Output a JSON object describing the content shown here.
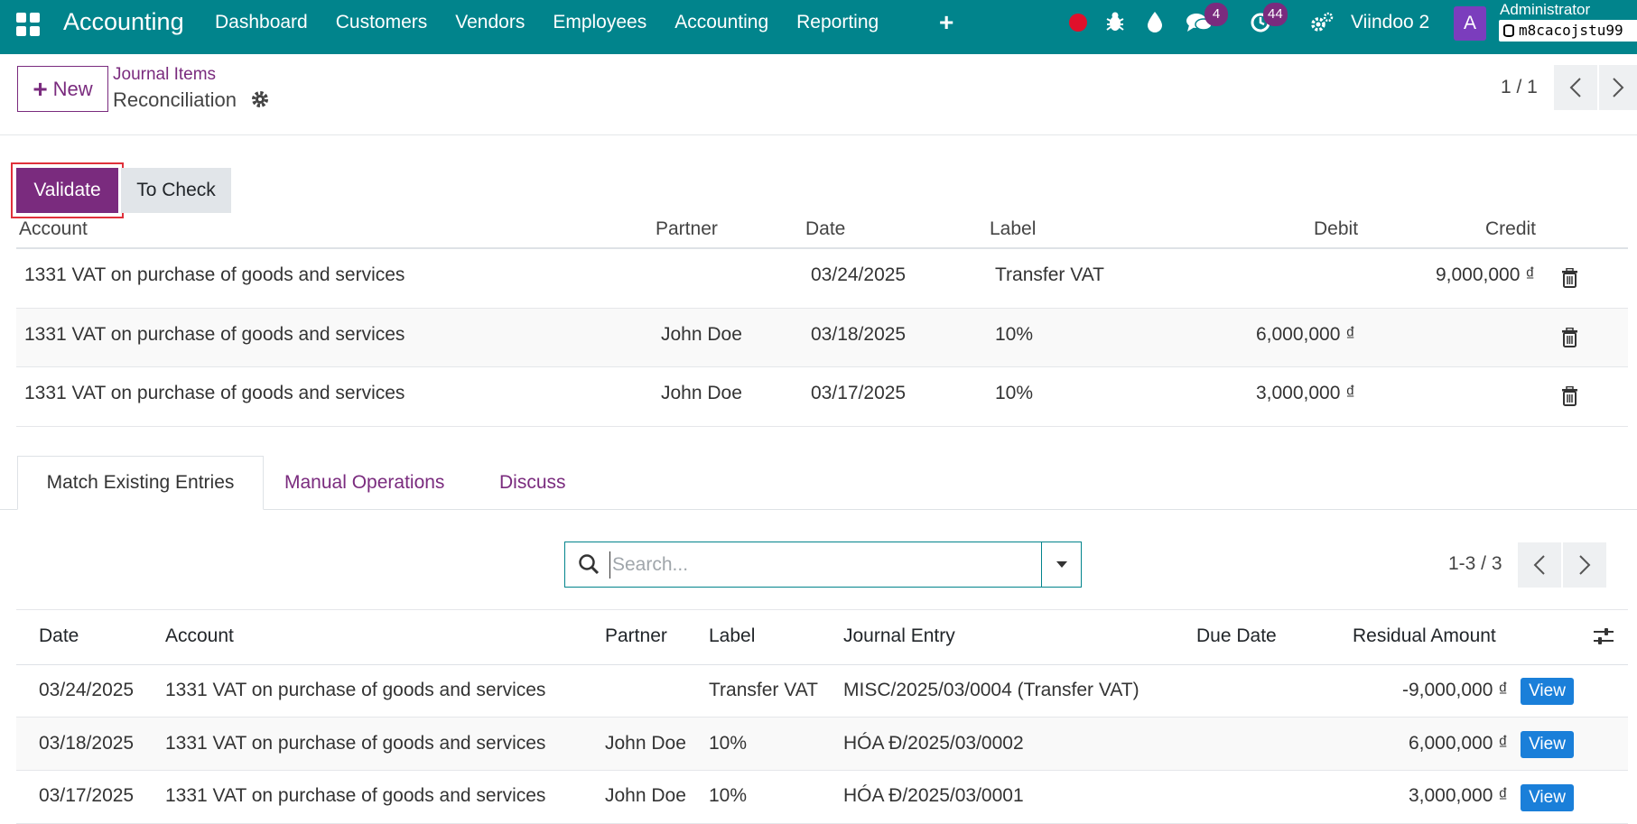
{
  "navbar": {
    "brand": "Accounting",
    "menu": [
      "Dashboard",
      "Customers",
      "Vendors",
      "Employees",
      "Accounting",
      "Reporting"
    ],
    "messages_badge": "4",
    "activities_badge": "44",
    "company": "Viindoo 2",
    "avatar_letter": "A",
    "user_name": "Administrator",
    "database": "m8cacojstu99"
  },
  "control": {
    "new_label": "New",
    "breadcrumb_parent": "Journal Items",
    "breadcrumb_current": "Reconciliation",
    "pager": "1 / 1"
  },
  "actions": {
    "validate_label": "Validate",
    "to_check_label": "To Check"
  },
  "lines": {
    "headers": {
      "account": "Account",
      "partner": "Partner",
      "date": "Date",
      "label": "Label",
      "debit": "Debit",
      "credit": "Credit"
    },
    "rows": [
      {
        "account": "1331 VAT on purchase of goods and services",
        "partner": "",
        "date": "03/24/2025",
        "label": "Transfer VAT",
        "debit": "",
        "credit": "9,000,000 ₫"
      },
      {
        "account": "1331 VAT on purchase of goods and services",
        "partner": "John Doe",
        "date": "03/18/2025",
        "label": "10%",
        "debit": "6,000,000 ₫",
        "credit": ""
      },
      {
        "account": "1331 VAT on purchase of goods and services",
        "partner": "John Doe",
        "date": "03/17/2025",
        "label": "10%",
        "debit": "3,000,000 ₫",
        "credit": ""
      }
    ]
  },
  "tabs": [
    "Match Existing Entries",
    "Manual Operations",
    "Discuss"
  ],
  "search": {
    "placeholder": "Search...",
    "pager": "1-3 / 3"
  },
  "entries": {
    "headers": {
      "date": "Date",
      "account": "Account",
      "partner": "Partner",
      "label": "Label",
      "journal_entry": "Journal Entry",
      "due_date": "Due Date",
      "residual": "Residual Amount"
    },
    "view_label": "View",
    "rows": [
      {
        "date": "03/24/2025",
        "account": "1331 VAT on purchase of goods and services",
        "partner": "",
        "label": "Transfer VAT",
        "journal_entry": "MISC/2025/03/0004 (Transfer VAT)",
        "due_date": "",
        "residual": "-9,000,000 ₫"
      },
      {
        "date": "03/18/2025",
        "account": "1331 VAT on purchase of goods and services",
        "partner": "John Doe",
        "label": "10%",
        "journal_entry": "HÓA Đ/2025/03/0002",
        "due_date": "",
        "residual": "6,000,000 ₫"
      },
      {
        "date": "03/17/2025",
        "account": "1331 VAT on purchase of goods and services",
        "partner": "John Doe",
        "label": "10%",
        "journal_entry": "HÓA Đ/2025/03/0001",
        "due_date": "",
        "residual": "3,000,000 ₫"
      }
    ]
  },
  "colors": {
    "navbar": "#01848c",
    "primary": "#7a2b7e",
    "view_button": "#1a7fd9",
    "highlight": "#e0313b"
  }
}
